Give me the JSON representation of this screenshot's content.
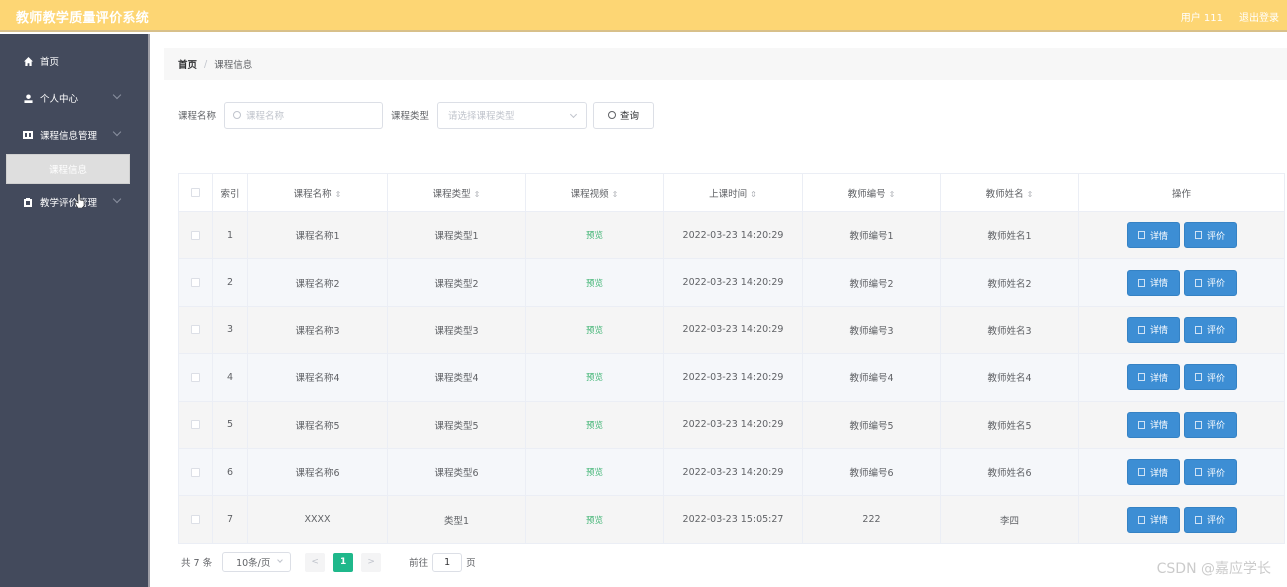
{
  "header": {
    "app_title": "教师教学质量评价系统",
    "user_label": "用户 111",
    "logout_label": "退出登录"
  },
  "sidebar": {
    "items": [
      {
        "label": "首页",
        "icon": "home-icon"
      },
      {
        "label": "个人中心",
        "icon": "user-icon"
      },
      {
        "label": "课程信息管理",
        "icon": "course-icon"
      },
      {
        "label": "教学评价管理",
        "icon": "evaluation-icon"
      }
    ],
    "active_subitem": "课程信息"
  },
  "breadcrumb": {
    "home": "首页",
    "separator": "/",
    "current": "课程信息"
  },
  "search": {
    "name_label": "课程名称",
    "name_placeholder": "课程名称",
    "name_value": "",
    "type_label": "课程类型",
    "type_placeholder": "请选择课程类型",
    "query_label": "查询"
  },
  "table": {
    "columns": [
      "索引",
      "课程名称",
      "课程类型",
      "课程视频",
      "上课时间",
      "教师编号",
      "教师姓名",
      "操作"
    ],
    "sort_glyph": "⇕",
    "rows": [
      {
        "index": "1",
        "name": "课程名称1",
        "type": "课程类型1",
        "video": "预览",
        "time": "2022-03-23 14:20:29",
        "teacher_no": "教师编号1",
        "teacher_name": "教师姓名1"
      },
      {
        "index": "2",
        "name": "课程名称2",
        "type": "课程类型2",
        "video": "预览",
        "time": "2022-03-23 14:20:29",
        "teacher_no": "教师编号2",
        "teacher_name": "教师姓名2"
      },
      {
        "index": "3",
        "name": "课程名称3",
        "type": "课程类型3",
        "video": "预览",
        "time": "2022-03-23 14:20:29",
        "teacher_no": "教师编号3",
        "teacher_name": "教师姓名3"
      },
      {
        "index": "4",
        "name": "课程名称4",
        "type": "课程类型4",
        "video": "预览",
        "time": "2022-03-23 14:20:29",
        "teacher_no": "教师编号4",
        "teacher_name": "教师姓名4"
      },
      {
        "index": "5",
        "name": "课程名称5",
        "type": "课程类型5",
        "video": "预览",
        "time": "2022-03-23 14:20:29",
        "teacher_no": "教师编号5",
        "teacher_name": "教师姓名5"
      },
      {
        "index": "6",
        "name": "课程名称6",
        "type": "课程类型6",
        "video": "预览",
        "time": "2022-03-23 14:20:29",
        "teacher_no": "教师编号6",
        "teacher_name": "教师姓名6"
      },
      {
        "index": "7",
        "name": "XXXX",
        "type": "类型1",
        "video": "预览",
        "time": "2022-03-23 15:05:27",
        "teacher_no": "222",
        "teacher_name": "李四"
      }
    ],
    "actions": {
      "detail": "详情",
      "evaluate": "评价"
    }
  },
  "pagination": {
    "total": "共 7 条",
    "page_size": "10条/页",
    "prev": "<",
    "current_page": "1",
    "next": ">",
    "goto_label": "前往",
    "goto_value": "1",
    "page_suffix": "页"
  },
  "watermark": "CSDN @嘉应学长",
  "colors": {
    "header_bg": "#fdd674",
    "sidebar_bg": "#434a5c",
    "action_button": "#3d8ed4",
    "current_page": "#1fb88b",
    "preview_link": "#3cb371"
  }
}
